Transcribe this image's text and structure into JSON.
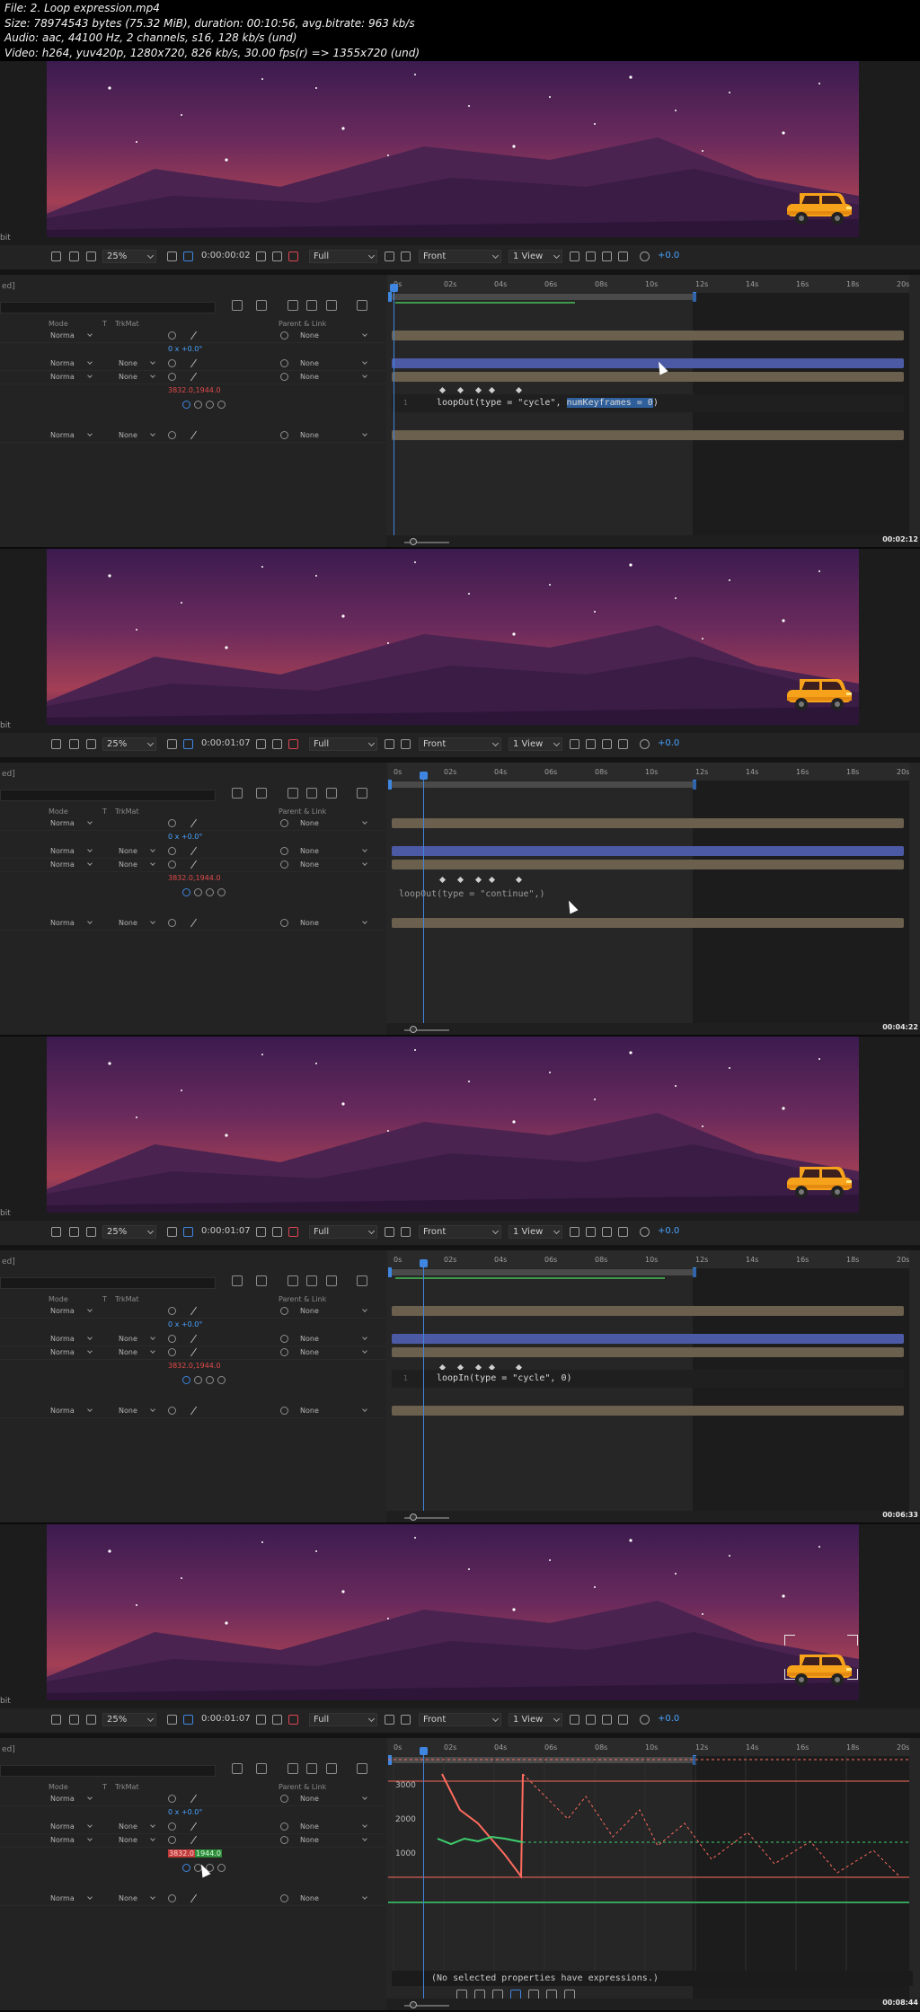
{
  "header": {
    "line1": "File: 2. Loop expression.mp4",
    "line2": "Size: 78974543 bytes (75.32 MiB), duration: 00:10:56, avg.bitrate: 963 kb/s",
    "line3": "Audio: aac, 44100 Hz, 2 channels, s16, 128 kb/s (und)",
    "line4": "Video: h264, yuv420p, 1280x720, 826 kb/s, 30.00 fps(r) => 1355x720 (und)"
  },
  "viewer_toolbar": {
    "zoom": "25%",
    "resolution": "Full",
    "view": "Front",
    "view_count": "1 View",
    "exposure": "+0.0"
  },
  "left_stubs": {
    "bit": "bit",
    "comp_tab": "ed]"
  },
  "timeline": {
    "columns": {
      "mode": "Mode",
      "t": "T",
      "trkmat": "TrkMat",
      "parent": "Parent & Link"
    },
    "ruler": [
      "0s",
      "02s",
      "04s",
      "06s",
      "08s",
      "10s",
      "12s",
      "14s",
      "16s",
      "18s",
      "20s"
    ],
    "rows": [
      {
        "mode": "Norma",
        "parent": "None"
      },
      {
        "mode": "Norma",
        "trkmat": "None",
        "parent": "None"
      },
      {
        "mode": "Norma",
        "trkmat": "None",
        "parent": "None"
      },
      {
        "mode": "Norma",
        "trkmat": "None",
        "parent": "None"
      }
    ],
    "rotation_value": "0 x +0.0°",
    "position_x": "3832.0",
    "position_y": "1944.0",
    "position_value": "3832.0,1944.0"
  },
  "frames": [
    {
      "timecode": "0:00:00:02",
      "expression": "loopOut(type = \"cycle\", numKeyframes = 0)",
      "expr_pre": "loopOut(type = \"cycle\", ",
      "expr_sel": "numKeyframes = 0",
      "expr_post": ")",
      "stamp": "00:02:12"
    },
    {
      "timecode": "0:00:01:07",
      "expression": "loopOut(type = \"continue\",)",
      "stamp": "00:04:22"
    },
    {
      "timecode": "0:00:01:07",
      "expression": "loopIn(type = \"cycle\",  0)",
      "stamp": "00:06:33"
    },
    {
      "timecode": "0:00:01:07",
      "graph_message": "(No selected properties have expressions.)",
      "graph_labels": [
        "3000",
        "2000",
        "1000"
      ],
      "stamp": "00:08:44"
    }
  ],
  "colors": {
    "accent_blue": "#3f86e0",
    "track_tan": "#6b5f4e",
    "track_blue": "#4c5aa5",
    "graph_red": "#ff6b5e",
    "graph_green": "#3ecf6e"
  },
  "icons": [
    "snapshot-icon",
    "color-icon",
    "grid-icon",
    "camera-icon",
    "graph-editor-icon",
    "solo-icon",
    "motion-blur-icon"
  ]
}
